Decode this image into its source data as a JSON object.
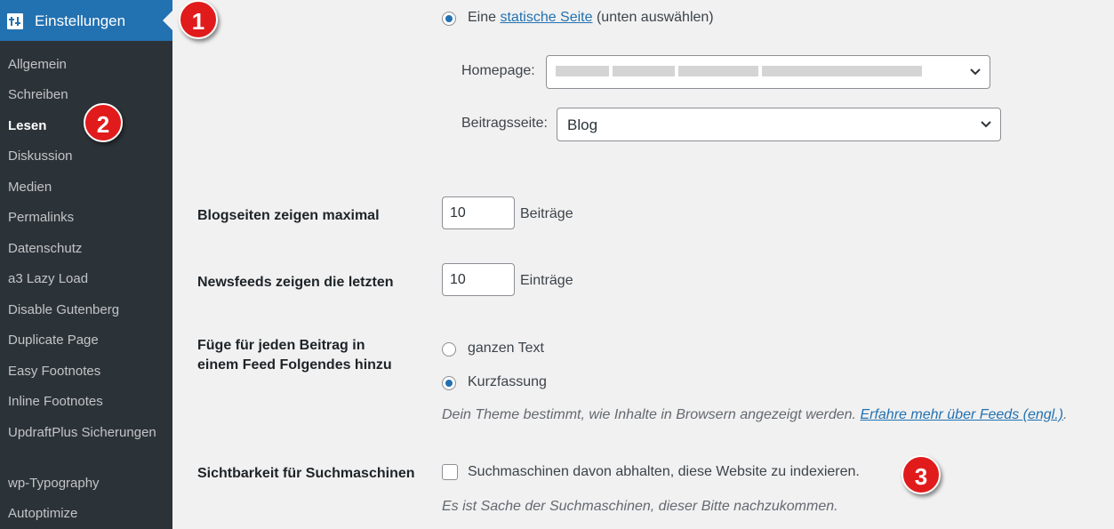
{
  "sidebar": {
    "menu_title": "Einstellungen",
    "items": [
      {
        "label": "Allgemein"
      },
      {
        "label": "Schreiben"
      },
      {
        "label": "Lesen",
        "current": true
      },
      {
        "label": "Diskussion"
      },
      {
        "label": "Medien"
      },
      {
        "label": "Permalinks"
      },
      {
        "label": "Datenschutz"
      },
      {
        "label": "a3 Lazy Load"
      },
      {
        "label": "Disable Gutenberg"
      },
      {
        "label": "Duplicate Page"
      },
      {
        "label": "Easy Footnotes"
      },
      {
        "label": "Inline Footnotes"
      },
      {
        "label": "UpdraftPlus Sicherungen"
      },
      {
        "label": "wp-Typography"
      },
      {
        "label": "Autoptimize"
      }
    ]
  },
  "homepage_display": {
    "static_option": {
      "prefix": "Eine ",
      "link": "statische Seite",
      "suffix": " (unten auswählen)",
      "selected": true
    },
    "homepage_label": "Homepage:",
    "homepage_value": "",
    "postspage_label": "Beitragsseite:",
    "postspage_value": "Blog"
  },
  "posts_per_page": {
    "label": "Blogseiten zeigen maximal",
    "value": "10",
    "unit": "Beiträge"
  },
  "posts_per_rss": {
    "label": "Newsfeeds zeigen die letzten",
    "value": "10",
    "unit": "Einträge"
  },
  "rss_use_excerpt": {
    "label_line1": "Füge für jeden Beitrag in",
    "label_line2": "einem Feed Folgendes hinzu",
    "options": [
      {
        "label": "ganzen Text",
        "selected": false
      },
      {
        "label": "Kurzfassung",
        "selected": true
      }
    ],
    "description": "Dein Theme bestimmt, wie Inhalte in Browsern angezeigt werden. ",
    "description_link": "Erfahre mehr über Feeds (engl.)",
    "description_end": "."
  },
  "blog_public": {
    "label": "Sichtbarkeit für Suchmaschinen",
    "checkbox_label": "Suchmaschinen davon abhalten, diese Website zu indexieren.",
    "checked": false,
    "description": "Es ist Sache der Suchmaschinen, dieser Bitte nachzukommen."
  },
  "badges": {
    "one": "1",
    "two": "2",
    "three": "3"
  },
  "colors": {
    "sidebar_bg": "#2c3338",
    "active_menu": "#2271b1",
    "accent": "#2271b1",
    "badge": "#e11b1b"
  }
}
